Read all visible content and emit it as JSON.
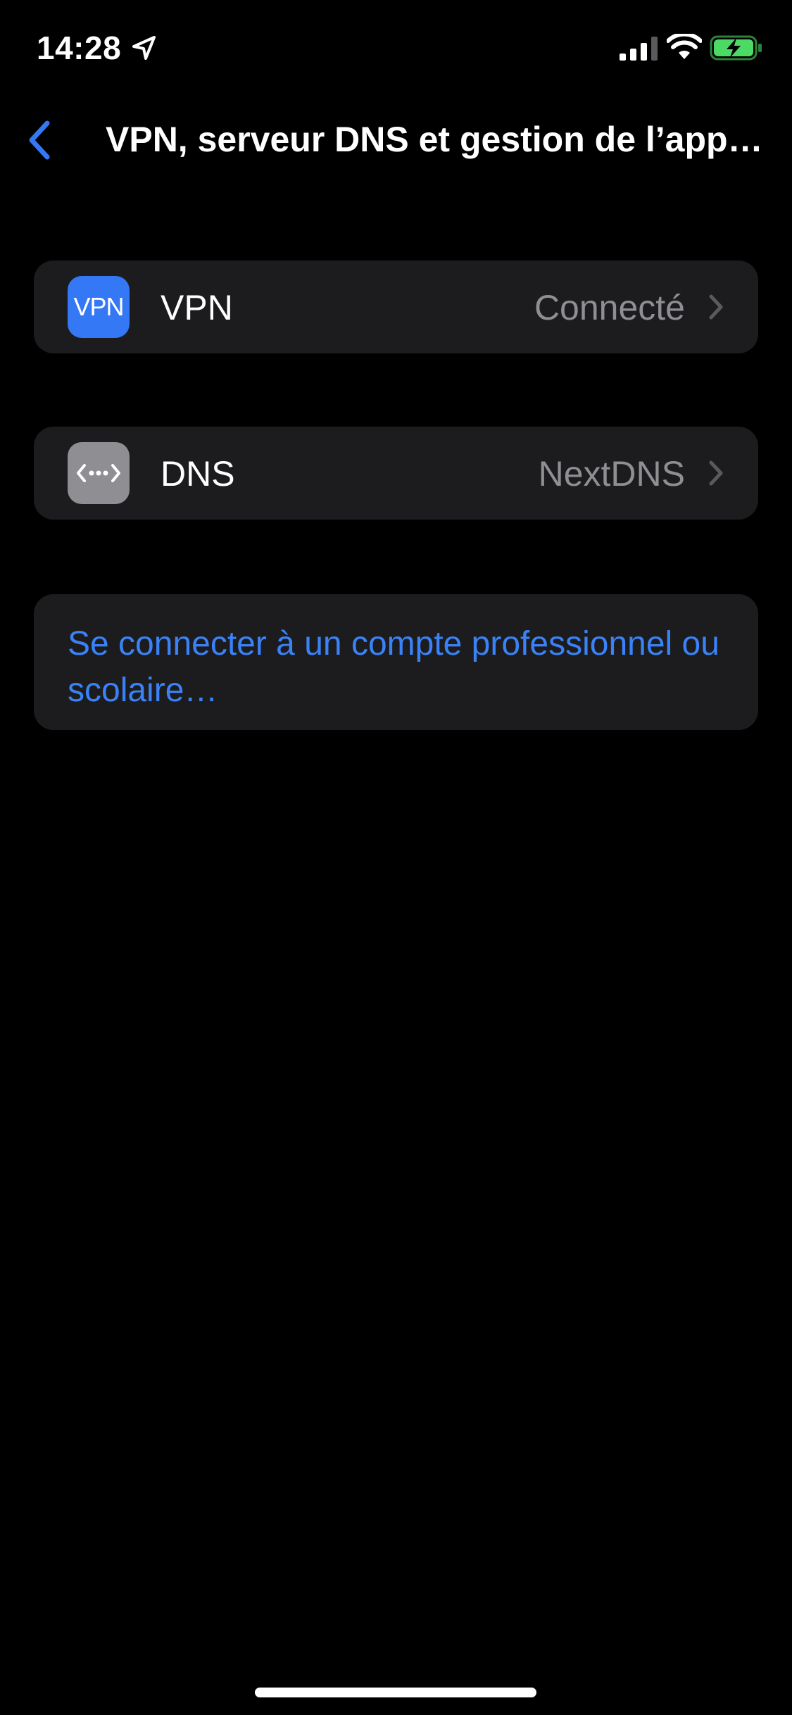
{
  "status_bar": {
    "time": "14:28",
    "icons": [
      "location-arrow-icon",
      "cellular-signal-icon",
      "wifi-icon",
      "battery-charging-icon"
    ],
    "battery_color": "#4cd964"
  },
  "nav": {
    "back_icon": "chevron-left-icon",
    "title": "VPN, serveur DNS et gestion de l’app…"
  },
  "rows": {
    "vpn": {
      "icon_text": "VPN",
      "label": "VPN",
      "value": "Connecté",
      "icon_color": "#3478f6"
    },
    "dns": {
      "icon": "dns-dots-icon",
      "label": "DNS",
      "value": "NextDNS",
      "icon_color": "#8e8e93"
    }
  },
  "link": {
    "text": "Se connecter à un compte professionnel ou scolaire…",
    "color": "#3a82f7"
  },
  "colors": {
    "background": "#000000",
    "cell_background": "#1c1c1e",
    "secondary_text": "#8e8e93",
    "accent": "#3478f6"
  }
}
